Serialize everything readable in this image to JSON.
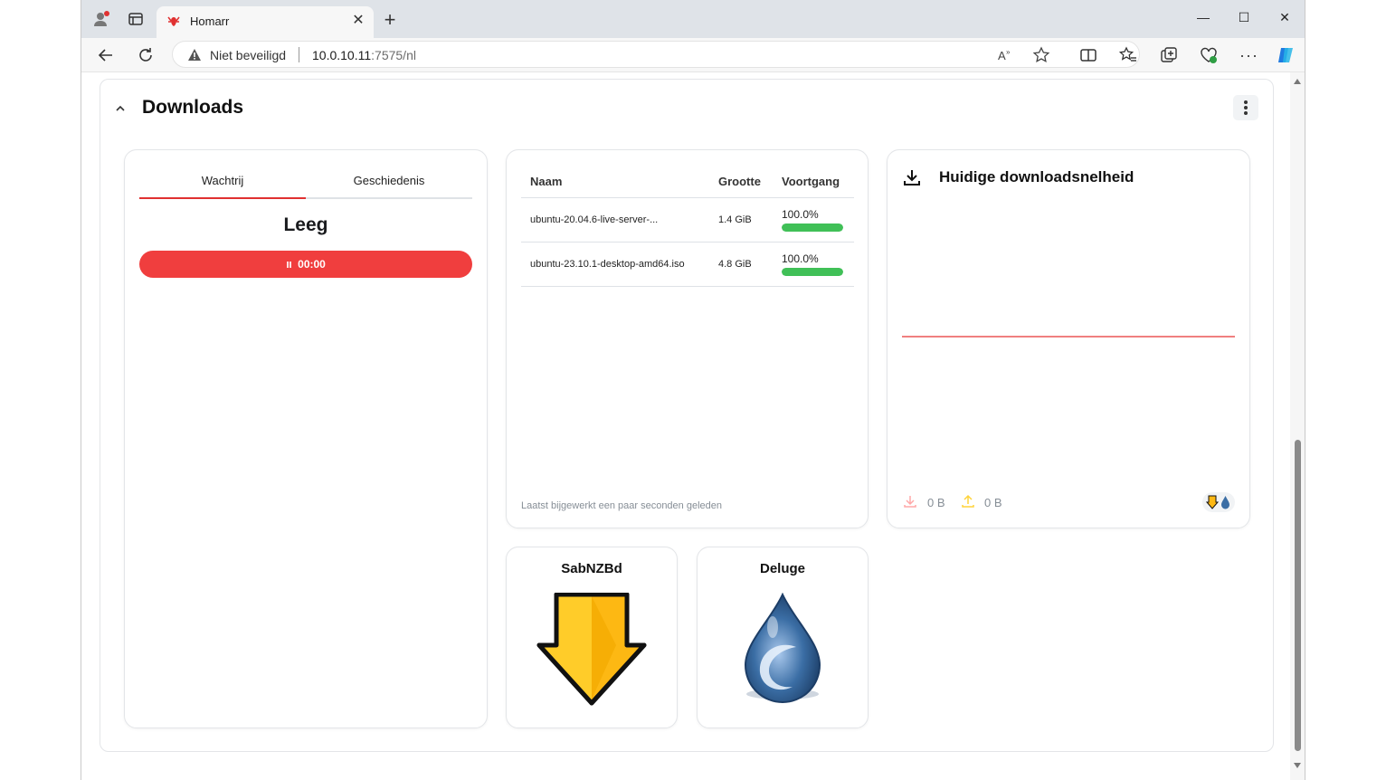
{
  "browser": {
    "tab_title": "Homarr",
    "security_label": "Niet beveiligd",
    "url_host": "10.0.10.11",
    "url_rest": ":7575/nl"
  },
  "category": {
    "title": "Downloads"
  },
  "queue": {
    "tabs": [
      "Wachtrij",
      "Geschiedenis"
    ],
    "active_tab": "Wachtrij",
    "status_title": "Leeg",
    "timer": "00:00"
  },
  "torrents": {
    "columns": {
      "name": "Naam",
      "size": "Grootte",
      "progress": "Voortgang"
    },
    "rows": [
      {
        "name": "ubuntu-20.04.6-live-server-...",
        "size": "1.4 GiB",
        "progress": "100.0%",
        "progress_value": 1.0
      },
      {
        "name": "ubuntu-23.10.1-desktop-amd64.iso",
        "size": "4.8 GiB",
        "progress": "100.0%",
        "progress_value": 1.0
      }
    ],
    "updated": "Laatst bijgewerkt een paar seconden geleden"
  },
  "speed": {
    "title": "Huidige downloadsnelheid",
    "download": "0 B",
    "upload": "0 B"
  },
  "apps": [
    {
      "name": "SabNZBd",
      "icon": "sabnzbd-arrow-icon"
    },
    {
      "name": "Deluge",
      "icon": "deluge-drop-icon"
    }
  ],
  "colors": {
    "accent_red": "#f03e3e",
    "progress_green": "#40c057",
    "sab_yellow": "#fdb813",
    "deluge_blue": "#3b6ea5"
  }
}
